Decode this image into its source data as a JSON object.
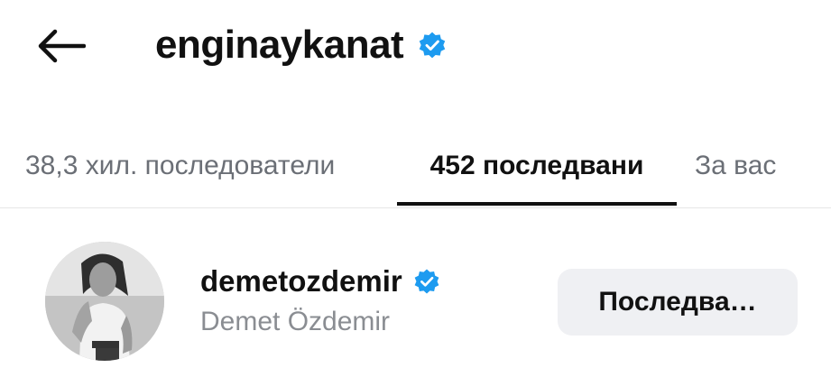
{
  "header": {
    "back_icon": "arrow-left-icon",
    "title": "enginaykanat",
    "verified_icon": "verified-badge-icon",
    "verified_color": "#1d9bf0"
  },
  "tabs": [
    {
      "label": "38,3 хил. последователи",
      "active": false
    },
    {
      "label": "452 последвани",
      "active": true
    },
    {
      "label": "За вас",
      "active": false
    }
  ],
  "list": [
    {
      "username": "demetozdemir",
      "full_name": "Demet Özdemir",
      "verified": true,
      "button_label": "Последва…"
    }
  ]
}
